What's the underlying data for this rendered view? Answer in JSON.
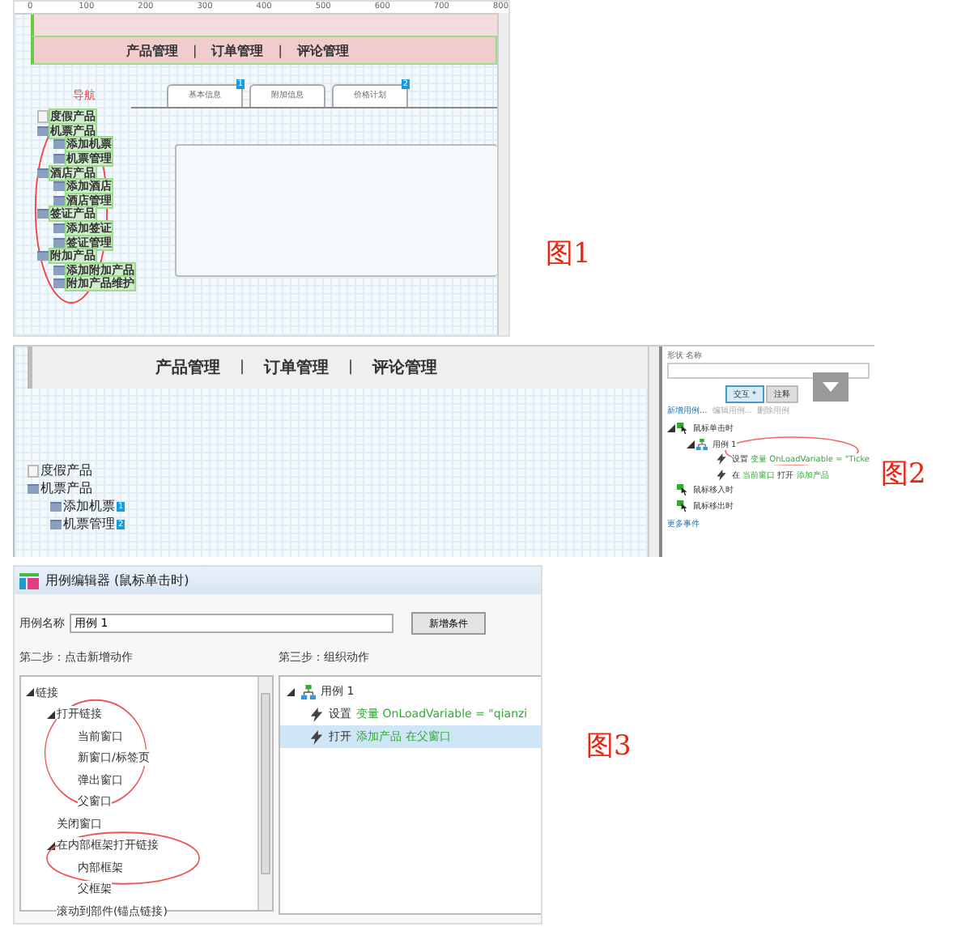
{
  "figure_1": {
    "ruler": [
      "0",
      "100",
      "200",
      "300",
      "400",
      "500",
      "600",
      "700",
      "800"
    ],
    "nav": [
      "产品管理",
      "|",
      "订单管理",
      "|",
      "评论管理"
    ],
    "tabs": [
      {
        "label": "基本信息",
        "badge": "1"
      },
      {
        "label": "附加信息"
      },
      {
        "label": "价格计划",
        "badge": "2"
      }
    ],
    "annotation": "导航",
    "tree": [
      {
        "label": "度假产品",
        "kind": "page"
      },
      {
        "label": "机票产品",
        "kind": "folder",
        "children": [
          {
            "label": "添加机票",
            "kind": "folder"
          },
          {
            "label": "机票管理",
            "kind": "folder"
          }
        ]
      },
      {
        "label": "酒店产品",
        "kind": "folder",
        "children": [
          {
            "label": "添加酒店",
            "kind": "folder"
          },
          {
            "label": "酒店管理",
            "kind": "folder"
          }
        ]
      },
      {
        "label": "签证产品",
        "kind": "folder",
        "children": [
          {
            "label": "添加签证",
            "kind": "folder"
          },
          {
            "label": "签证管理",
            "kind": "folder"
          }
        ]
      },
      {
        "label": "附加产品",
        "kind": "folder",
        "children": [
          {
            "label": "添加附加产品",
            "kind": "folder"
          },
          {
            "label": "附加产品维护",
            "kind": "folder"
          }
        ]
      }
    ],
    "caption": "图1"
  },
  "figure_2": {
    "nav": [
      "产品管理",
      "|",
      "订单管理",
      "|",
      "评论管理"
    ],
    "tree": [
      {
        "label": "度假产品",
        "kind": "page"
      },
      {
        "label": "机票产品",
        "kind": "folder",
        "children": [
          {
            "label": "添加机票",
            "kind": "folder",
            "badge": "1"
          },
          {
            "label": "机票管理",
            "kind": "folder",
            "badge": "2"
          }
        ]
      }
    ],
    "panel": {
      "header": "形状 名称",
      "tabs": [
        {
          "label": "交互 *",
          "selected": true
        },
        {
          "label": "注释",
          "selected": false
        }
      ],
      "links": [
        "新增用例...",
        "编辑用例...",
        "删除用例"
      ],
      "events": [
        {
          "kind": "event",
          "parts": [
            {
              "text": "鼠标单击时"
            }
          ],
          "expanded": true,
          "children": [
            {
              "kind": "case",
              "parts": [
                {
                  "text": "用例 1"
                }
              ],
              "expanded": true,
              "children": [
                {
                  "kind": "action",
                  "parts": [
                    {
                      "text": "设置"
                    },
                    {
                      "text": "变量 OnLoadVariable = \"Ticke",
                      "kind": "value"
                    }
                  ]
                },
                {
                  "kind": "action",
                  "parts": [
                    {
                      "text": "在"
                    },
                    {
                      "text": "当前窗口",
                      "kind": "value"
                    },
                    {
                      "text": "打开"
                    },
                    {
                      "text": "添加产品",
                      "kind": "value"
                    }
                  ]
                }
              ]
            }
          ]
        },
        {
          "kind": "event",
          "parts": [
            {
              "text": "鼠标移入时"
            }
          ]
        },
        {
          "kind": "event",
          "parts": [
            {
              "text": "鼠标移出时"
            }
          ]
        }
      ],
      "more": "更多事件"
    },
    "caption": "图2"
  },
  "figure_3": {
    "title": "用例编辑器 (鼠标单击时)",
    "name_label": "用例名称",
    "name_value": "用例 1",
    "add_button": "新增条件",
    "step_2": "第二步：点击新增动作",
    "step_3": "第三步：组织动作",
    "actions": [
      {
        "label": "链接",
        "expanded": true,
        "children": [
          {
            "label": "打开链接",
            "expanded": true,
            "children": [
              {
                "label": "当前窗口"
              },
              {
                "label": "新窗口/标签页"
              },
              {
                "label": "弹出窗口"
              },
              {
                "label": "父窗口"
              }
            ]
          },
          {
            "label": "关闭窗口"
          },
          {
            "label": "在内部框架打开链接",
            "expanded": true,
            "children": [
              {
                "label": "内部框架"
              },
              {
                "label": "父框架"
              }
            ]
          },
          {
            "label": "滚动到部件(锚点链接)"
          }
        ]
      }
    ],
    "organized": [
      {
        "kind": "case",
        "parts": [
          {
            "text": "用例 1"
          }
        ],
        "expanded": true,
        "selected": false,
        "children": [
          {
            "kind": "action",
            "selected": false,
            "parts": [
              {
                "text": "设置"
              },
              {
                "text": "变量 OnLoadVariable = \"qianzi",
                "kind": "value"
              }
            ]
          },
          {
            "kind": "action",
            "selected": true,
            "parts": [
              {
                "text": "打开"
              },
              {
                "text": "添加产品 在父窗口",
                "kind": "value"
              }
            ]
          }
        ]
      }
    ],
    "caption": "图3"
  }
}
